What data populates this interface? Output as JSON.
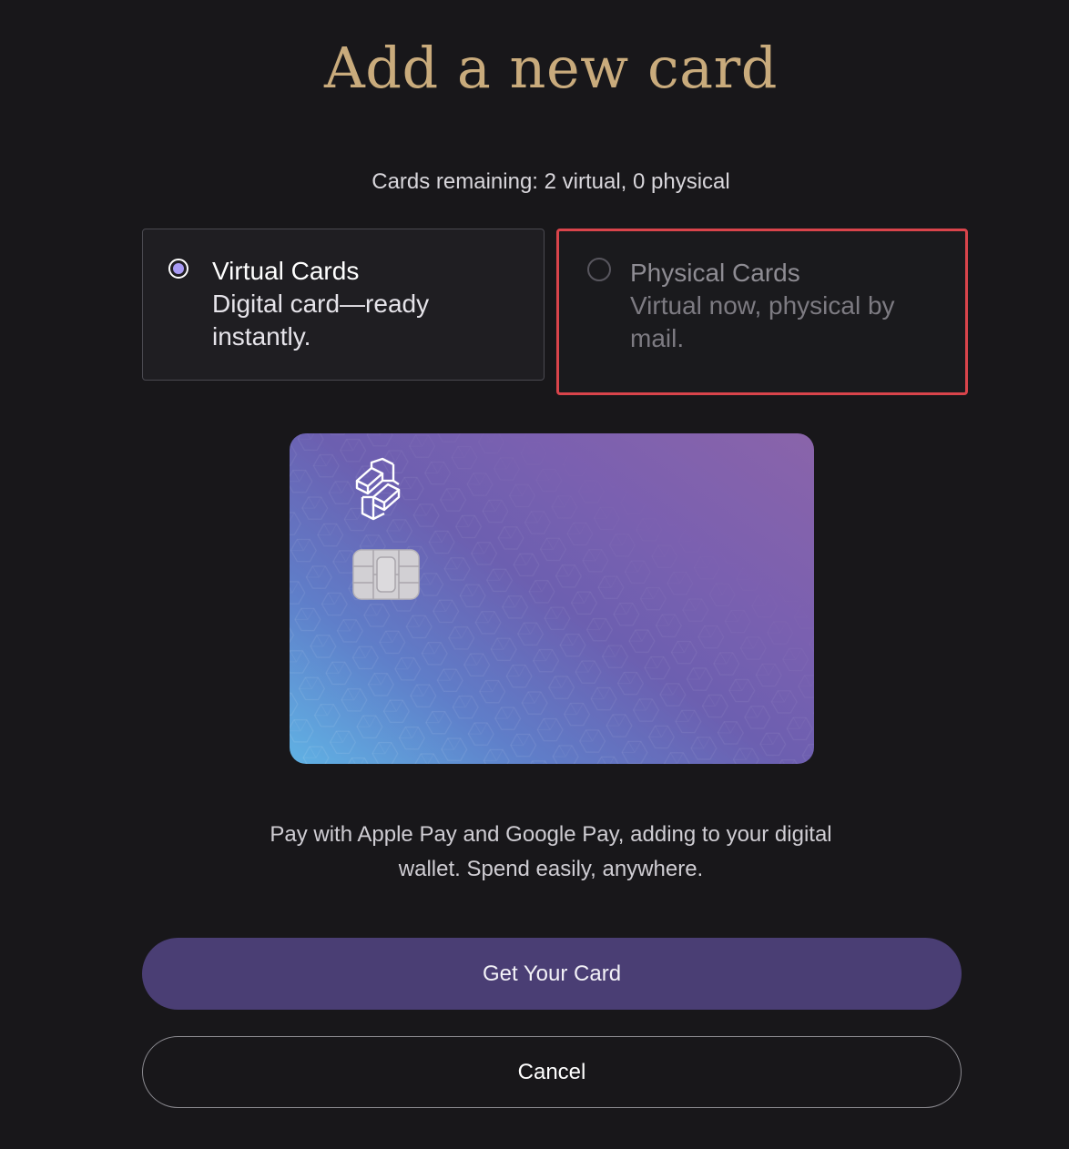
{
  "header": {
    "title": "Add a new card",
    "remaining": "Cards remaining: 2 virtual, 0 physical"
  },
  "options": [
    {
      "id": "virtual",
      "title": "Virtual Cards",
      "description": "Digital card—ready instantly.",
      "selected": true
    },
    {
      "id": "physical",
      "title": "Physical Cards",
      "description": "Virtual now, physical by mail.",
      "selected": false,
      "disabled": true
    }
  ],
  "card_preview": {
    "logo_icon": "brand-logo-icon",
    "chip_icon": "card-chip-icon",
    "gradient_colors": [
      "#8a64aa",
      "#6c5fb0",
      "#60b2e4"
    ]
  },
  "caption": {
    "line1": "Pay with Apple Pay and Google Pay, adding to your digital",
    "line2": "wallet. Spend easily, anywhere."
  },
  "actions": {
    "primary_label": "Get Your Card",
    "secondary_label": "Cancel"
  },
  "colors": {
    "background": "#18171a",
    "title": "#c9ab7c",
    "accent": "#a99bf5",
    "primary_button": "#4a3e74",
    "highlight_border": "#d9444b"
  }
}
